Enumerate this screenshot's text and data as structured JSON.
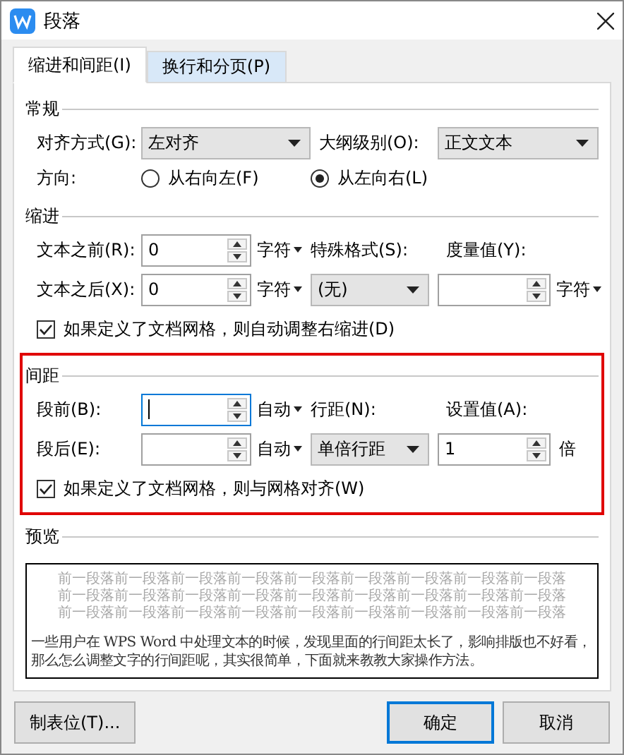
{
  "window": {
    "title": "段落"
  },
  "tabs": [
    {
      "label": "缩进和间距(I)",
      "selected": true
    },
    {
      "label": "换行和分页(P)",
      "selected": false
    }
  ],
  "general": {
    "heading": "常规",
    "alignment": {
      "label": "对齐方式(G):",
      "value": "左对齐"
    },
    "outline_level": {
      "label": "大纲级别(O):",
      "value": "正文文本"
    },
    "direction": {
      "label": "方向:",
      "options": [
        {
          "label": "从右向左(F)",
          "selected": false
        },
        {
          "label": "从左向右(L)",
          "selected": true
        }
      ]
    }
  },
  "indent": {
    "heading": "缩进",
    "before": {
      "label": "文本之前(R):",
      "value": "0",
      "unit": "字符",
      "focused": false
    },
    "after": {
      "label": "文本之后(X):",
      "value": "0",
      "unit": "字符",
      "focused": false
    },
    "special": {
      "label": "特殊格式(S):",
      "value": "(无)"
    },
    "measure": {
      "label": "度量值(Y):",
      "unit": "字符",
      "focused": false
    },
    "grid_option": {
      "label": "如果定义了文档网格，则自动调整右缩进(D)",
      "checked": true
    }
  },
  "spacing": {
    "heading": "间距",
    "before": {
      "label": "段前(B):",
      "unit": "自动",
      "focused": true
    },
    "after": {
      "label": "段后(E):",
      "unit": "自动",
      "focused": false
    },
    "line_spacing": {
      "label": "行距(N):",
      "value": "单倍行距"
    },
    "setting": {
      "label": "设置值(A):",
      "value": "1",
      "unit": "倍",
      "focused": false
    },
    "grid_option": {
      "label": "如果定义了文档网格，则与网格对齐(W)",
      "checked": true
    }
  },
  "preview": {
    "heading": "预览",
    "previous_lines": [
      "前一段落前一段落前一段落前一段落前一段落前一段落前一段落前一段落前一段落",
      "前一段落前一段落前一段落前一段落前一段落前一段落前一段落前一段落前一段落",
      "前一段落前一段落前一段落前一段落前一段落前一段落前一段落前一段落前一段落"
    ],
    "paragraph": [
      "一些用户在 WPS Word 中处理文本的时候，发现里面的行间距太长了，影响排版也不好看，",
      "那么怎么调整文字的行间距呢，其实很简单，下面就来教教大家操作方法。"
    ]
  },
  "buttons": [
    {
      "label": "制表位(T)...",
      "kind": "normal"
    },
    {
      "label": "确定",
      "kind": "default"
    },
    {
      "label": "取消",
      "kind": "normal"
    }
  ]
}
